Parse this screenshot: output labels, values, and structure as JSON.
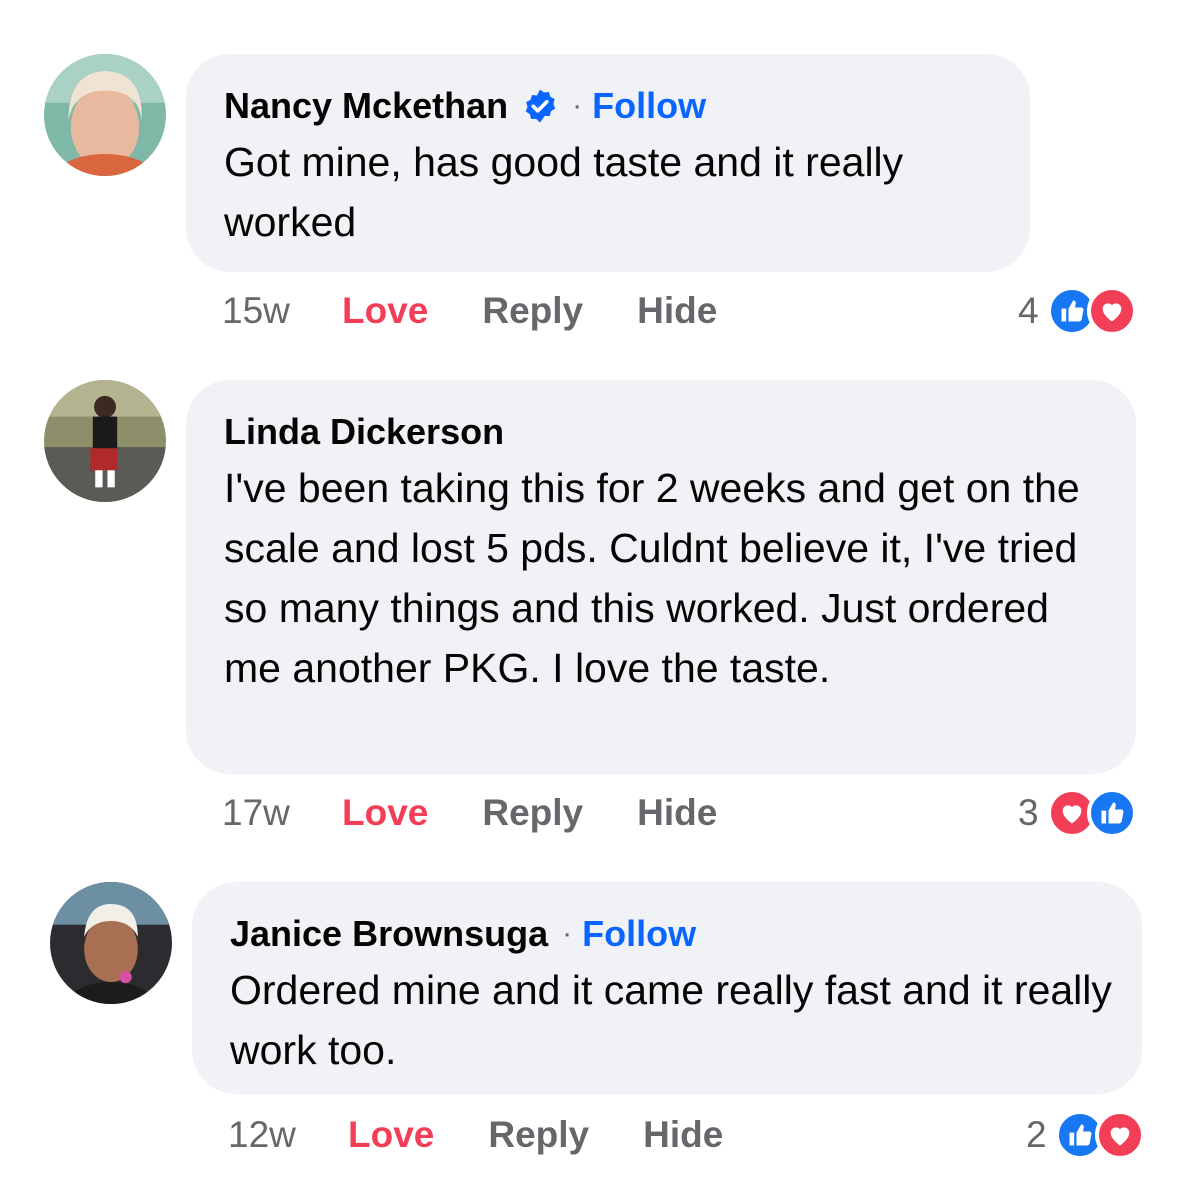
{
  "colors": {
    "bubble": "#f0f2f5",
    "follow": "#0866ff",
    "love": "#f33e58",
    "muted": "#65676b",
    "like": "#1877f2"
  },
  "comments": [
    {
      "author": "Nancy Mckethan",
      "verified": true,
      "follow_label": "Follow",
      "text": "Got mine, has good taste and it really worked",
      "time": "15w",
      "love_label": "Love",
      "reply_label": "Reply",
      "hide_label": "Hide",
      "reaction_count": "4",
      "reactions": [
        "like-icon",
        "love-icon"
      ]
    },
    {
      "author": "Linda Dickerson",
      "verified": false,
      "follow_label": "",
      "text": "I've been taking this for 2 weeks and get on the scale and lost 5 pds. Culdnt believe it, I've tried so many things and this worked. Just ordered me another PKG. I love the taste.",
      "time": "17w",
      "love_label": "Love",
      "reply_label": "Reply",
      "hide_label": "Hide",
      "reaction_count": "3",
      "reactions": [
        "love-icon",
        "like-icon"
      ]
    },
    {
      "author": "Janice Brownsuga",
      "verified": false,
      "follow_label": "Follow",
      "text": "Ordered mine and it came really fast and it really work too.",
      "time": "12w",
      "love_label": "Love",
      "reply_label": "Reply",
      "hide_label": "Hide",
      "reaction_count": "2",
      "reactions": [
        "like-icon",
        "love-icon"
      ]
    }
  ]
}
